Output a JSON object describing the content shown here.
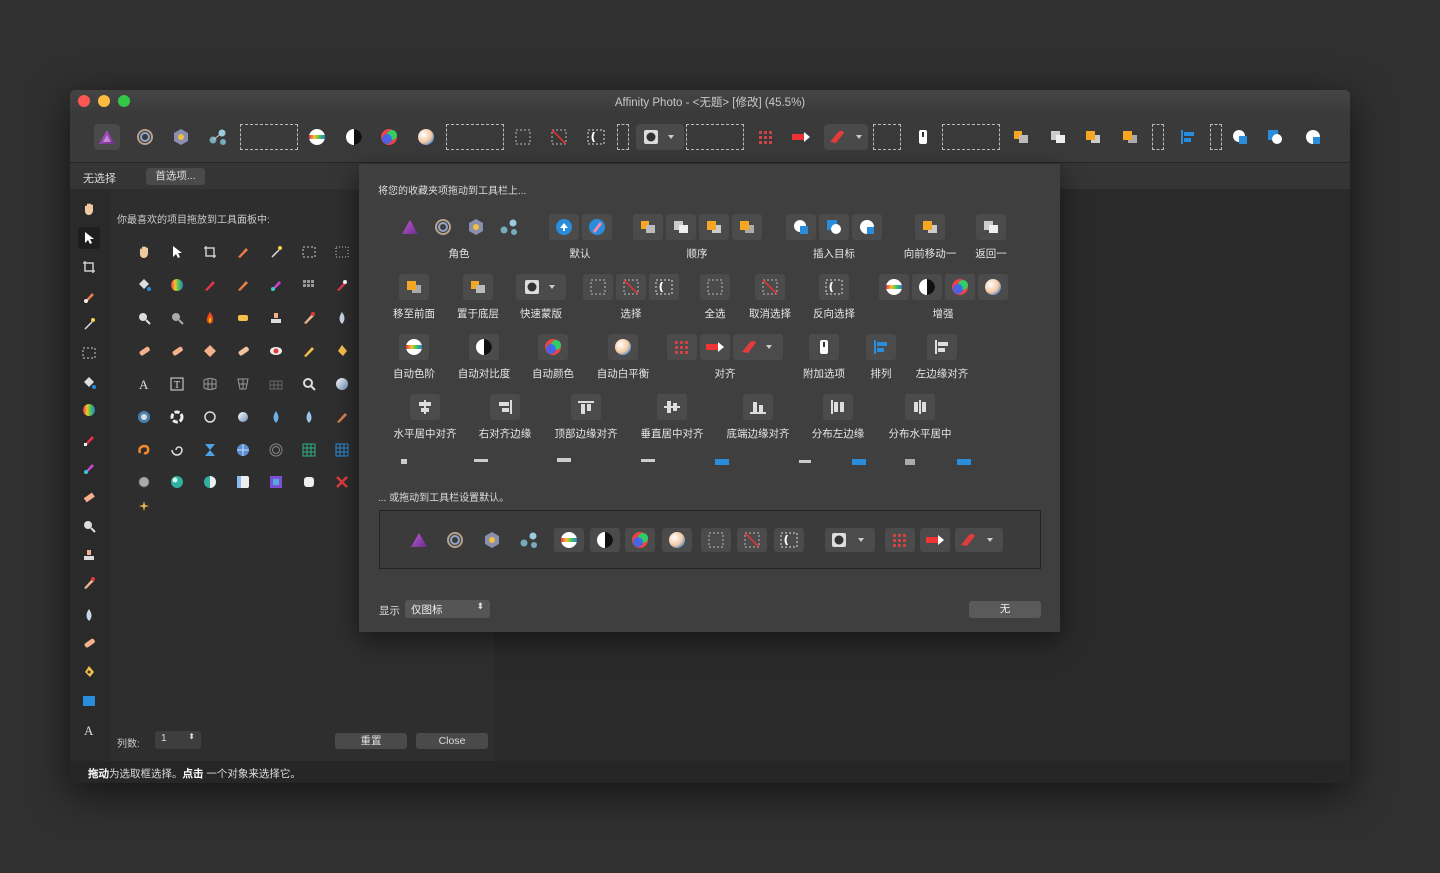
{
  "window": {
    "title": "Affinity Photo - <无题> [修改] (45.5%)"
  },
  "context_bar": {
    "selection_label": "无选择",
    "prefs_button": "首选项..."
  },
  "tools_panel": {
    "hint": "你最喜欢的项目拖放到工具面板中:",
    "columns_label": "列数:",
    "columns_value": "1",
    "reset_button": "重置",
    "close_button": "Close"
  },
  "dialog": {
    "hint_top": "将您的收藏夹项拖动到工具栏上...",
    "hint_default": "... 或拖动到工具栏设置默认。",
    "show_label": "显示",
    "show_value": "仅图标",
    "none_button": "无",
    "items": [
      {
        "label": "角色"
      },
      {
        "label": "默认"
      },
      {
        "label": "顺序"
      },
      {
        "label": "插入目标"
      },
      {
        "label": "向前移动一"
      },
      {
        "label": "返回一"
      },
      {
        "label": "移至前面"
      },
      {
        "label": "置于底层"
      },
      {
        "label": "快速蒙版"
      },
      {
        "label": "选择"
      },
      {
        "label": "全选"
      },
      {
        "label": "取消选择"
      },
      {
        "label": "反向选择"
      },
      {
        "label": "增强"
      },
      {
        "label": "自动色阶"
      },
      {
        "label": "自动对比度"
      },
      {
        "label": "自动颜色"
      },
      {
        "label": "自动白平衡"
      },
      {
        "label": "对齐"
      },
      {
        "label": "附加选项"
      },
      {
        "label": "排列"
      },
      {
        "label": "左边缘对齐"
      },
      {
        "label": "水平居中对齐"
      },
      {
        "label": "右对齐边缘"
      },
      {
        "label": "顶部边缘对齐"
      },
      {
        "label": "垂直居中对齐"
      },
      {
        "label": "底端边缘对齐"
      },
      {
        "label": "分布左边缘"
      },
      {
        "label": "分布水平居中"
      }
    ]
  },
  "status": {
    "drag_word": "拖动",
    "drag_text": "为选取框选择。",
    "click_word": "点击",
    "click_text": " 一个对象来选择它。"
  },
  "colors": {
    "accent_blue": "#2a8ddb",
    "red": "#e03c3c",
    "background": "#303030"
  }
}
